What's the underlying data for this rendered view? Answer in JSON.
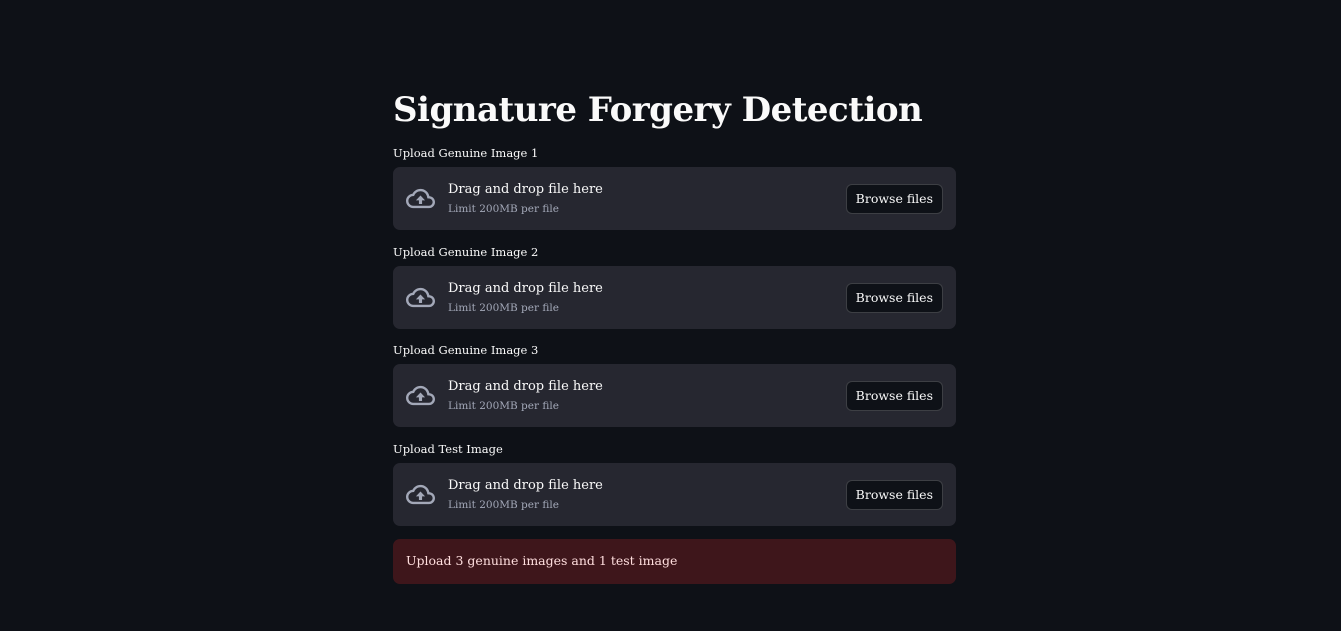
{
  "page": {
    "title": "Signature Forgery Detection"
  },
  "uploaders": [
    {
      "label": "Upload Genuine Image 1",
      "drop_text": "Drag and drop file here",
      "limit_text": "Limit 200MB per file",
      "button_label": "Browse files",
      "icon": "cloud-upload-icon"
    },
    {
      "label": "Upload Genuine Image 2",
      "drop_text": "Drag and drop file here",
      "limit_text": "Limit 200MB per file",
      "button_label": "Browse files",
      "icon": "cloud-upload-icon"
    },
    {
      "label": "Upload Genuine Image 3",
      "drop_text": "Drag and drop file here",
      "limit_text": "Limit 200MB per file",
      "button_label": "Browse files",
      "icon": "cloud-upload-icon"
    },
    {
      "label": "Upload Test Image",
      "drop_text": "Drag and drop file here",
      "limit_text": "Limit 200MB per file",
      "button_label": "Browse files",
      "icon": "cloud-upload-icon"
    }
  ],
  "alert": {
    "text": "Upload 3 genuine images and 1 test image",
    "type": "error"
  },
  "colors": {
    "background": "#0e1117",
    "dropzone": "#262730",
    "text": "#fafafa",
    "muted_text": "#a3a8b8",
    "alert_background": "#3e2428",
    "alert_text": "#ffdede"
  }
}
